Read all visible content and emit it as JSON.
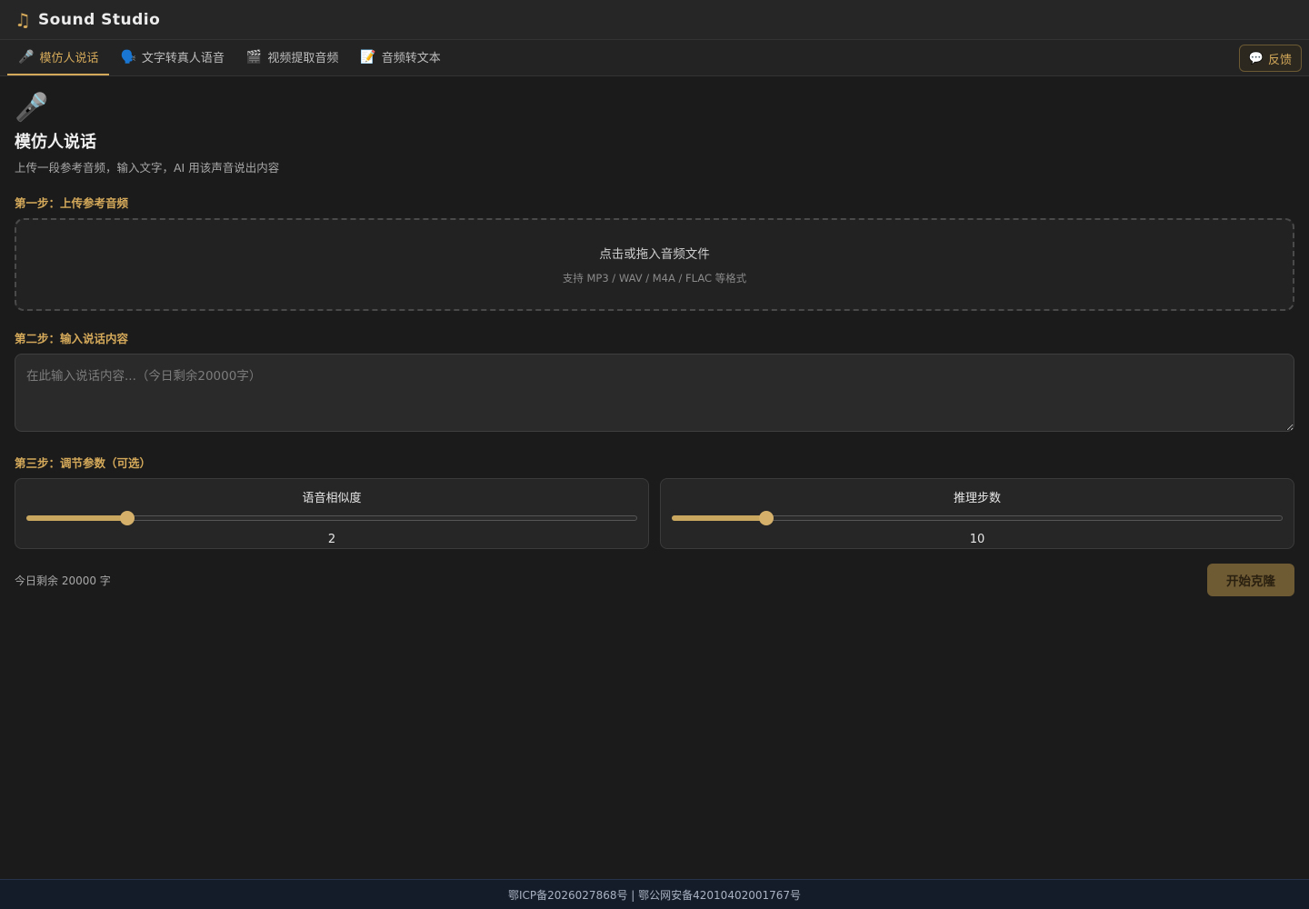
{
  "app": {
    "title": "Sound Studio",
    "logo_icon": "♫"
  },
  "tabs": [
    {
      "icon": "🎤",
      "label": "模仿人说话",
      "active": true
    },
    {
      "icon": "🗣️",
      "label": "文字转真人语音",
      "active": false
    },
    {
      "icon": "🎬",
      "label": "视频提取音频",
      "active": false
    },
    {
      "icon": "📝",
      "label": "音频转文本",
      "active": false
    }
  ],
  "feedback": {
    "icon": "💬",
    "label": "反馈"
  },
  "page": {
    "icon": "🎤",
    "title": "模仿人说话",
    "subtitle": "上传一段参考音频，输入文字，AI 用该声音说出内容"
  },
  "step1": {
    "label": "第一步：上传参考音频",
    "dropzone_main": "点击或拖入音频文件",
    "dropzone_sub": "支持 MP3 / WAV / M4A / FLAC 等格式"
  },
  "step2": {
    "label": "第二步：输入说话内容",
    "placeholder": "在此输入说话内容...（今日剩余20000字）",
    "value": ""
  },
  "step3": {
    "label": "第三步：调节参数（可选）",
    "params": [
      {
        "title": "语音相似度",
        "value": "2",
        "fill_fraction": 0.165
      },
      {
        "title": "推理步数",
        "value": "10",
        "fill_fraction": 0.155
      }
    ]
  },
  "quota": "今日剩余 20000 字",
  "start_button": "开始克隆",
  "footer": "鄂ICP备2026027868号 | 鄂公网安备42010402001767号",
  "colors": {
    "accent": "#d4a95a",
    "background": "#1b1b1b",
    "footer_bg": "#151c29"
  }
}
